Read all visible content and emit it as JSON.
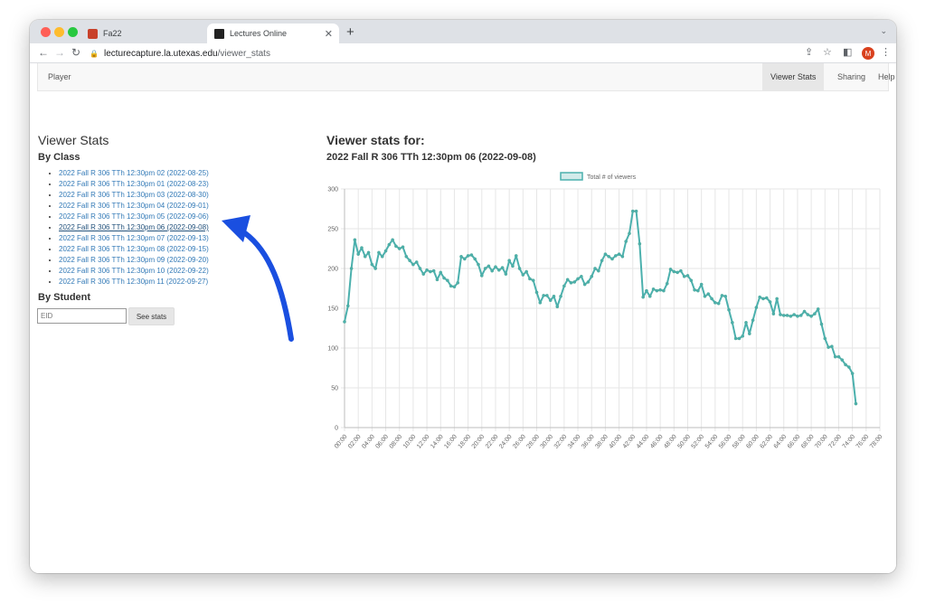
{
  "browser": {
    "tabs": [
      {
        "title": "Fa22",
        "active": false
      },
      {
        "title": "Lectures Online",
        "active": true
      }
    ],
    "url_host": "lecturecapture.la.utexas.edu",
    "url_path": "/viewer_stats",
    "profile_initial": "M",
    "new_tab": "+",
    "tab_menu": "⌄"
  },
  "navbar": {
    "brand": "Player",
    "items": [
      {
        "label": "Viewer Stats",
        "active": true
      },
      {
        "label": "Sharing",
        "active": false
      },
      {
        "label": "Help",
        "active": false
      }
    ]
  },
  "left": {
    "title": "Viewer Stats",
    "by_class": "By Class",
    "classes": [
      "2022 Fall R 306 TTh 12:30pm 02 (2022-08-25)",
      "2022 Fall R 306 TTh 12:30pm 01 (2022-08-23)",
      "2022 Fall R 306 TTh 12:30pm 03 (2022-08-30)",
      "2022 Fall R 306 TTh 12:30pm 04 (2022-09-01)",
      "2022 Fall R 306 TTh 12:30pm 05 (2022-09-06)",
      "2022 Fall R 306 TTh 12:30pm 06 (2022-09-08)",
      "2022 Fall R 306 TTh 12:30pm 07 (2022-09-13)",
      "2022 Fall R 306 TTh 12:30pm 08 (2022-09-15)",
      "2022 Fall R 306 TTh 12:30pm 09 (2022-09-20)",
      "2022 Fall R 306 TTh 12:30pm 10 (2022-09-22)",
      "2022 Fall R 306 TTh 12:30pm 11 (2022-09-27)"
    ],
    "current_class_index": 5,
    "by_student": "By Student",
    "eid_placeholder": "EID",
    "see_stats": "See stats"
  },
  "right": {
    "title": "Viewer stats for:",
    "subtitle": "2022 Fall R 306 TTh 12:30pm 06 (2022-09-08)"
  },
  "colors": {
    "line": "#4bb0ad",
    "link": "#337ab7",
    "arrow": "#1a4fe0"
  },
  "chart_data": {
    "type": "line",
    "title": "",
    "xlabel": "",
    "ylabel": "",
    "legend": "top",
    "grid": true,
    "ylim": [
      0,
      300
    ],
    "y_ticks": [
      0,
      50,
      100,
      150,
      200,
      250,
      300
    ],
    "x_ticks": [
      "00:00",
      "02:00",
      "04:00",
      "06:00",
      "08:00",
      "10:00",
      "12:00",
      "14:00",
      "16:00",
      "18:00",
      "20:00",
      "22:00",
      "24:00",
      "26:00",
      "28:00",
      "30:00",
      "32:00",
      "34:00",
      "36:00",
      "38:00",
      "40:00",
      "42:00",
      "44:00",
      "46:00",
      "48:00",
      "50:00",
      "52:00",
      "54:00",
      "56:00",
      "58:00",
      "60:00",
      "62:00",
      "64:00",
      "66:00",
      "68:00",
      "70:00",
      "72:00",
      "74:00",
      "76:00",
      "78:00"
    ],
    "series": [
      {
        "name": "Total # of viewers",
        "x_minutes": [
          0,
          0.5,
          1,
          1.5,
          2,
          2.5,
          3,
          3.5,
          4,
          4.5,
          5,
          5.5,
          6,
          6.5,
          7,
          7.5,
          8,
          8.5,
          9,
          9.5,
          10,
          10.5,
          11,
          11.5,
          12,
          12.5,
          13,
          13.5,
          14,
          14.5,
          15,
          15.5,
          16,
          16.5,
          17,
          17.5,
          18,
          18.5,
          19,
          19.5,
          20,
          20.5,
          21,
          21.5,
          22,
          22.5,
          23,
          23.5,
          24,
          24.5,
          25,
          25.5,
          26,
          26.5,
          27,
          27.5,
          28,
          28.5,
          29,
          29.5,
          30,
          30.5,
          31,
          31.5,
          32,
          32.5,
          33,
          33.5,
          34,
          34.5,
          35,
          35.5,
          36,
          36.5,
          37,
          37.5,
          38,
          38.5,
          39,
          39.5,
          40,
          40.5,
          41,
          41.5,
          42,
          42.5,
          43,
          43.5,
          44,
          44.5,
          45,
          45.5,
          46,
          46.5,
          47,
          47.5,
          48,
          48.5,
          49,
          49.5,
          50,
          50.5,
          51,
          51.5,
          52,
          52.5,
          53,
          53.5,
          54,
          54.5,
          55,
          55.5,
          56,
          56.5,
          57,
          57.5,
          58,
          58.5,
          59,
          59.5,
          60,
          60.5,
          61,
          61.5,
          62,
          62.5,
          63,
          63.5,
          64,
          64.5,
          65,
          65.5,
          66,
          66.5,
          67,
          67.5,
          68,
          68.5,
          69,
          69.5,
          70,
          70.5,
          71,
          71.5,
          72,
          72.5,
          73,
          73.5,
          74,
          74.5,
          75,
          75.5,
          76,
          76.5,
          77,
          77.5,
          78
        ],
        "values": [
          133,
          153,
          200,
          236,
          218,
          226,
          215,
          220,
          205,
          200,
          220,
          215,
          222,
          230,
          236,
          228,
          225,
          227,
          215,
          210,
          205,
          208,
          200,
          193,
          198,
          196,
          197,
          186,
          195,
          188,
          185,
          178,
          177,
          182,
          215,
          212,
          216,
          217,
          212,
          205,
          191,
          200,
          203,
          197,
          202,
          198,
          201,
          193,
          210,
          203,
          216,
          200,
          192,
          196,
          187,
          185,
          170,
          157,
          166,
          166,
          160,
          165,
          152,
          165,
          178,
          186,
          182,
          183,
          187,
          190,
          180,
          183,
          190,
          200,
          197,
          210,
          218,
          215,
          212,
          216,
          218,
          215,
          234,
          244,
          272,
          272,
          231,
          164,
          172,
          165,
          174,
          172,
          173,
          172,
          181,
          199,
          196,
          195,
          197,
          190,
          191,
          185,
          173,
          172,
          180,
          165,
          168,
          162,
          157,
          156,
          166,
          165,
          148,
          132,
          112,
          112,
          115,
          132,
          118,
          135,
          151,
          164,
          162,
          163,
          158,
          143,
          162,
          142,
          141,
          141,
          140,
          142,
          140,
          141,
          146,
          142,
          140,
          143,
          149,
          130,
          112,
          101,
          102,
          89,
          89,
          85,
          79,
          76,
          68,
          30
        ]
      }
    ]
  }
}
